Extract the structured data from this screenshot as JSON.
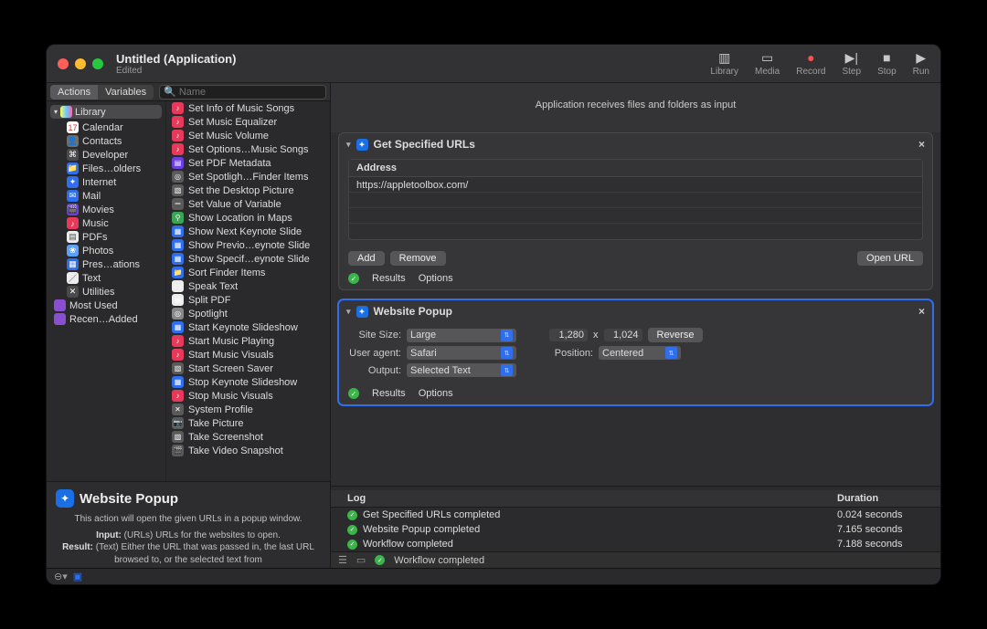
{
  "window": {
    "title": "Untitled (Application)",
    "subtitle": "Edited"
  },
  "toolbar": {
    "items": [
      {
        "name": "library",
        "label": "Library",
        "glyph": "▥"
      },
      {
        "name": "media",
        "label": "Media",
        "glyph": "▭"
      },
      {
        "name": "record",
        "label": "Record",
        "glyph": "●",
        "cls": "rec"
      },
      {
        "name": "step",
        "label": "Step",
        "glyph": "▶|"
      },
      {
        "name": "stop",
        "label": "Stop",
        "glyph": "■"
      },
      {
        "name": "run",
        "label": "Run",
        "glyph": "▶"
      }
    ]
  },
  "left_tabs": {
    "actions": "Actions",
    "variables": "Variables"
  },
  "search_placeholder": "Name",
  "library": {
    "group": "Library",
    "items": [
      {
        "label": "Calendar",
        "bg": "#ffffff",
        "fg": "#e03030",
        "g": "17"
      },
      {
        "label": "Contacts",
        "bg": "#6e6e6e",
        "g": "👤"
      },
      {
        "label": "Developer",
        "bg": "#4a4a4a",
        "g": "⌘"
      },
      {
        "label": "Files…olders",
        "bg": "#2f6fed",
        "g": "📁"
      },
      {
        "label": "Internet",
        "bg": "#2f6fed",
        "g": "✦"
      },
      {
        "label": "Mail",
        "bg": "#2f6fed",
        "g": "✉"
      },
      {
        "label": "Movies",
        "bg": "#6e3fe0",
        "g": "🎬"
      },
      {
        "label": "Music",
        "bg": "#e8395a",
        "g": "♪"
      },
      {
        "label": "PDFs",
        "bg": "#ececec",
        "fg": "#555",
        "g": "▤"
      },
      {
        "label": "Photos",
        "bg": "#5aa0ff",
        "g": "❀"
      },
      {
        "label": "Pres…ations",
        "bg": "#2f6fed",
        "g": "▦"
      },
      {
        "label": "Text",
        "bg": "#ececec",
        "fg": "#333",
        "g": "／"
      },
      {
        "label": "Utilities",
        "bg": "#4a4a4a",
        "g": "✕"
      }
    ],
    "extra": [
      {
        "label": "Most Used",
        "bg": "#8a4fd0"
      },
      {
        "label": "Recen…Added",
        "bg": "#8a4fd0"
      }
    ]
  },
  "actions": [
    {
      "ic": "#e8395a",
      "g": "♪",
      "label": "Set Info of Music Songs"
    },
    {
      "ic": "#e8395a",
      "g": "♪",
      "label": "Set Music Equalizer"
    },
    {
      "ic": "#e8395a",
      "g": "♪",
      "label": "Set Music Volume"
    },
    {
      "ic": "#e8395a",
      "g": "♪",
      "label": "Set Options…Music Songs"
    },
    {
      "ic": "#6e3fe0",
      "g": "▤",
      "label": "Set PDF Metadata"
    },
    {
      "ic": "#5a5a5a",
      "g": "◎",
      "label": "Set Spotligh…Finder Items"
    },
    {
      "ic": "#5a5a5a",
      "g": "▧",
      "label": "Set the Desktop Picture"
    },
    {
      "ic": "#5a5a5a",
      "g": "＝",
      "label": "Set Value of Variable"
    },
    {
      "ic": "#3aa655",
      "g": "⚲",
      "label": "Show Location in Maps"
    },
    {
      "ic": "#2f6fed",
      "g": "▦",
      "label": "Show Next Keynote Slide"
    },
    {
      "ic": "#2f6fed",
      "g": "▦",
      "label": "Show Previo…eynote Slide"
    },
    {
      "ic": "#2f6fed",
      "g": "▦",
      "label": "Show Specif…eynote Slide"
    },
    {
      "ic": "#2f6fed",
      "g": "📁",
      "label": "Sort Finder Items"
    },
    {
      "ic": "#ececec",
      "g": "▭",
      "label": "Speak Text"
    },
    {
      "ic": "#ececec",
      "g": "▤",
      "label": "Split PDF"
    },
    {
      "ic": "#888888",
      "g": "◎",
      "label": "Spotlight"
    },
    {
      "ic": "#2f6fed",
      "g": "▦",
      "label": "Start Keynote Slideshow"
    },
    {
      "ic": "#e8395a",
      "g": "♪",
      "label": "Start Music Playing"
    },
    {
      "ic": "#e8395a",
      "g": "♪",
      "label": "Start Music Visuals"
    },
    {
      "ic": "#5a5a5a",
      "g": "▧",
      "label": "Start Screen Saver"
    },
    {
      "ic": "#2f6fed",
      "g": "▦",
      "label": "Stop Keynote Slideshow"
    },
    {
      "ic": "#e8395a",
      "g": "♪",
      "label": "Stop Music Visuals"
    },
    {
      "ic": "#5a5a5a",
      "g": "✕",
      "label": "System Profile"
    },
    {
      "ic": "#5a5a5a",
      "g": "📷",
      "label": "Take Picture"
    },
    {
      "ic": "#5a5a5a",
      "g": "▧",
      "label": "Take Screenshot"
    },
    {
      "ic": "#5a5a5a",
      "g": "🎬",
      "label": "Take Video Snapshot"
    }
  ],
  "description": {
    "title": "Website Popup",
    "body": "This action will open the given URLs in a popup window.",
    "input_label": "Input:",
    "input_text": "(URLs) URLs for the websites to open.",
    "result_label": "Result:",
    "result_text": "(Text) Either the URL that was passed in, the last URL browsed to, or the selected text from"
  },
  "workflow": {
    "header": "Application receives files and folders as input",
    "action1": {
      "title": "Get Specified URLs",
      "addr_header": "Address",
      "url": "https://appletoolbox.com/",
      "add": "Add",
      "remove": "Remove",
      "open": "Open URL",
      "results": "Results",
      "options": "Options"
    },
    "action2": {
      "title": "Website Popup",
      "size_label": "Site Size:",
      "size_val": "Large",
      "agent_label": "User agent:",
      "agent_val": "Safari",
      "output_label": "Output:",
      "output_val": "Selected Text",
      "w": "1,280",
      "h": "1,024",
      "x": "x",
      "reverse": "Reverse",
      "pos_label": "Position:",
      "pos_val": "Centered",
      "results": "Results",
      "options": "Options"
    }
  },
  "log": {
    "h1": "Log",
    "h2": "Duration",
    "rows": [
      {
        "msg": "Get Specified URLs completed",
        "dur": "0.024 seconds"
      },
      {
        "msg": "Website Popup completed",
        "dur": "7.165 seconds"
      },
      {
        "msg": "Workflow completed",
        "dur": "7.188 seconds"
      }
    ]
  },
  "status": "Workflow completed"
}
